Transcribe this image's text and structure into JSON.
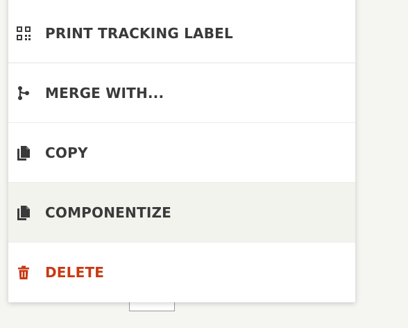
{
  "menu": {
    "items": [
      {
        "id": "print_tracking_label",
        "label": "PRINT TRACKING LABEL",
        "icon": "qr-code-icon"
      },
      {
        "id": "merge_with",
        "label": "MERGE WITH...",
        "icon": "merge-icon"
      },
      {
        "id": "copy",
        "label": "COPY",
        "icon": "copy-icon"
      },
      {
        "id": "componentize",
        "label": "COMPONENTIZE",
        "icon": "copy-icon"
      },
      {
        "id": "delete",
        "label": "DELETE",
        "icon": "trash-icon"
      }
    ],
    "selected_index": 3
  },
  "colors": {
    "text": "#3a3a3a",
    "danger": "#c83a12",
    "selected_bg": "#f3f3ee",
    "divider": "#ececec"
  }
}
